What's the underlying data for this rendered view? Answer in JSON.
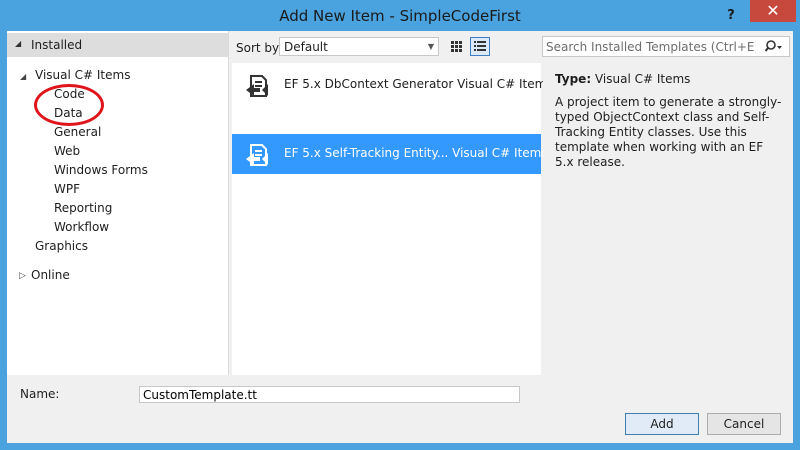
{
  "window": {
    "title": "Add New Item - SimpleCodeFirst",
    "help_label": "?",
    "close_label": "✕"
  },
  "left": {
    "installed_label": "Installed",
    "tree": [
      {
        "label": "Visual C# Items",
        "expanded": true
      },
      {
        "label": "Code"
      },
      {
        "label": "Data"
      },
      {
        "label": "General"
      },
      {
        "label": "Web"
      },
      {
        "label": "Windows Forms"
      },
      {
        "label": "WPF"
      },
      {
        "label": "Reporting"
      },
      {
        "label": "Workflow"
      },
      {
        "label": "Graphics"
      },
      {
        "label": "Online",
        "expanded": false
      }
    ]
  },
  "toolbar": {
    "sort_label": "Sort by:",
    "sort_value": "Default",
    "search_placeholder": "Search Installed Templates (Ctrl+E)"
  },
  "templates": [
    {
      "name": "EF 5.x DbContext Generator Visual C# Items",
      "selected": false
    },
    {
      "name": "EF 5.x Self-Tracking Entity... Visual C# Items",
      "selected": true
    }
  ],
  "details": {
    "type_label": "Type:",
    "type_value": "Visual C# Items",
    "description": "A project item to generate a strongly-typed ObjectContext class and Self-Tracking Entity classes. Use this template when working with an EF 5.x release."
  },
  "footer": {
    "name_label": "Name:",
    "name_value": "CustomTemplate.tt",
    "add_label": "Add",
    "cancel_label": "Cancel"
  },
  "colors": {
    "title_bar": "#4aa3df",
    "close_button": "#c7483d",
    "selection": "#3399ff",
    "annotation_circle": "#e0151c"
  }
}
